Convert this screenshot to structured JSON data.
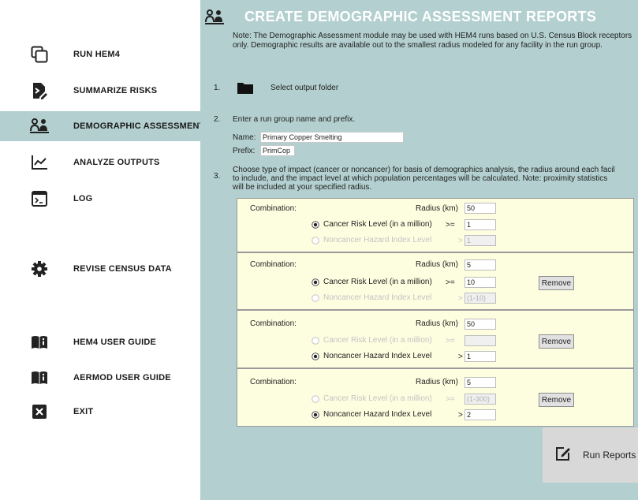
{
  "sidebar": {
    "items": [
      {
        "label": "RUN HEM4",
        "icon": "copy-windows-icon"
      },
      {
        "label": "SUMMARIZE RISKS",
        "icon": "document-edit-icon"
      },
      {
        "label": "DEMOGRAPHIC ASSESSMENT",
        "icon": "people-icon"
      },
      {
        "label": "ANALYZE OUTPUTS",
        "icon": "line-chart-icon"
      },
      {
        "label": "LOG",
        "icon": "terminal-icon"
      },
      {
        "label": "REVISE CENSUS DATA",
        "icon": "gear-icon"
      },
      {
        "label": "HEM4 USER GUIDE",
        "icon": "book-info-icon"
      },
      {
        "label": "AERMOD USER GUIDE",
        "icon": "book-info-icon"
      },
      {
        "label": "EXIT",
        "icon": "close-icon"
      }
    ],
    "active_index": 2
  },
  "main": {
    "title": "CREATE DEMOGRAPHIC ASSESSMENT REPORTS",
    "note": "Note: The Demographic Assessment module may be used with HEM4 runs based on U.S. Census Block receptors only. Demographic results are available out to the smallest radius modeled for any facility in the run group.",
    "step1": {
      "number": "1.",
      "label": "Select output folder"
    },
    "step2": {
      "number": "2.",
      "label": "Enter a run group name and prefix.",
      "name_label": "Name:",
      "name_value": "Primary Copper Smelting",
      "prefix_label": "Prefix:",
      "prefix_value": "PrimCop"
    },
    "step3": {
      "number": "3.",
      "line1": "Choose type of impact (cancer or noncancer) for basis of demographics analysis, the radius around each facil",
      "line2": "to include, and the impact level at which population percentages will be calculated. Note: proximity statistics",
      "line3": "will be included at your specified radius."
    },
    "combinations": [
      {
        "label": "Combination:",
        "radius_label": "Radius (km)",
        "radius": "50",
        "cancer_label": "Cancer Risk Level (in a million)",
        "cancer_op": ">=",
        "cancer_value": "1",
        "noncancer_label": "Noncancer Hazard Index Level",
        "noncancer_op": ">",
        "noncancer_value": "1",
        "selected": "cancer",
        "remove": ""
      },
      {
        "label": "Combination:",
        "radius_label": "Radius (km)",
        "radius": "5",
        "cancer_label": "Cancer Risk Level (in a million)",
        "cancer_op": ">=",
        "cancer_value": "10",
        "noncancer_label": "Noncancer Hazard Index Level",
        "noncancer_op": ">",
        "noncancer_value": "(1-10)",
        "selected": "cancer",
        "remove": "Remove"
      },
      {
        "label": "Combination:",
        "radius_label": "Radius (km)",
        "radius": "50",
        "cancer_label": "Cancer Risk Level (in a million)",
        "cancer_op": ">=",
        "cancer_value": "",
        "noncancer_label": "Noncancer Hazard Index Level",
        "noncancer_op": ">",
        "noncancer_value": "1",
        "selected": "noncancer",
        "remove": "Remove"
      },
      {
        "label": "Combination:",
        "radius_label": "Radius (km)",
        "radius": "5",
        "cancer_label": "Cancer Risk Level (in a million)",
        "cancer_op": ">=",
        "cancer_value": "(1-300)",
        "noncancer_label": "Noncancer Hazard Index Level",
        "noncancer_op": ">",
        "noncancer_value": "2",
        "selected": "noncancer",
        "remove": "Remove"
      }
    ],
    "run_reports_label": "Run Reports"
  },
  "colors": {
    "main_bg": "#b3cfcf",
    "combo_bg": "#fdfde0",
    "title": "#ffffff",
    "disabled_text": "#c4c4c4"
  }
}
